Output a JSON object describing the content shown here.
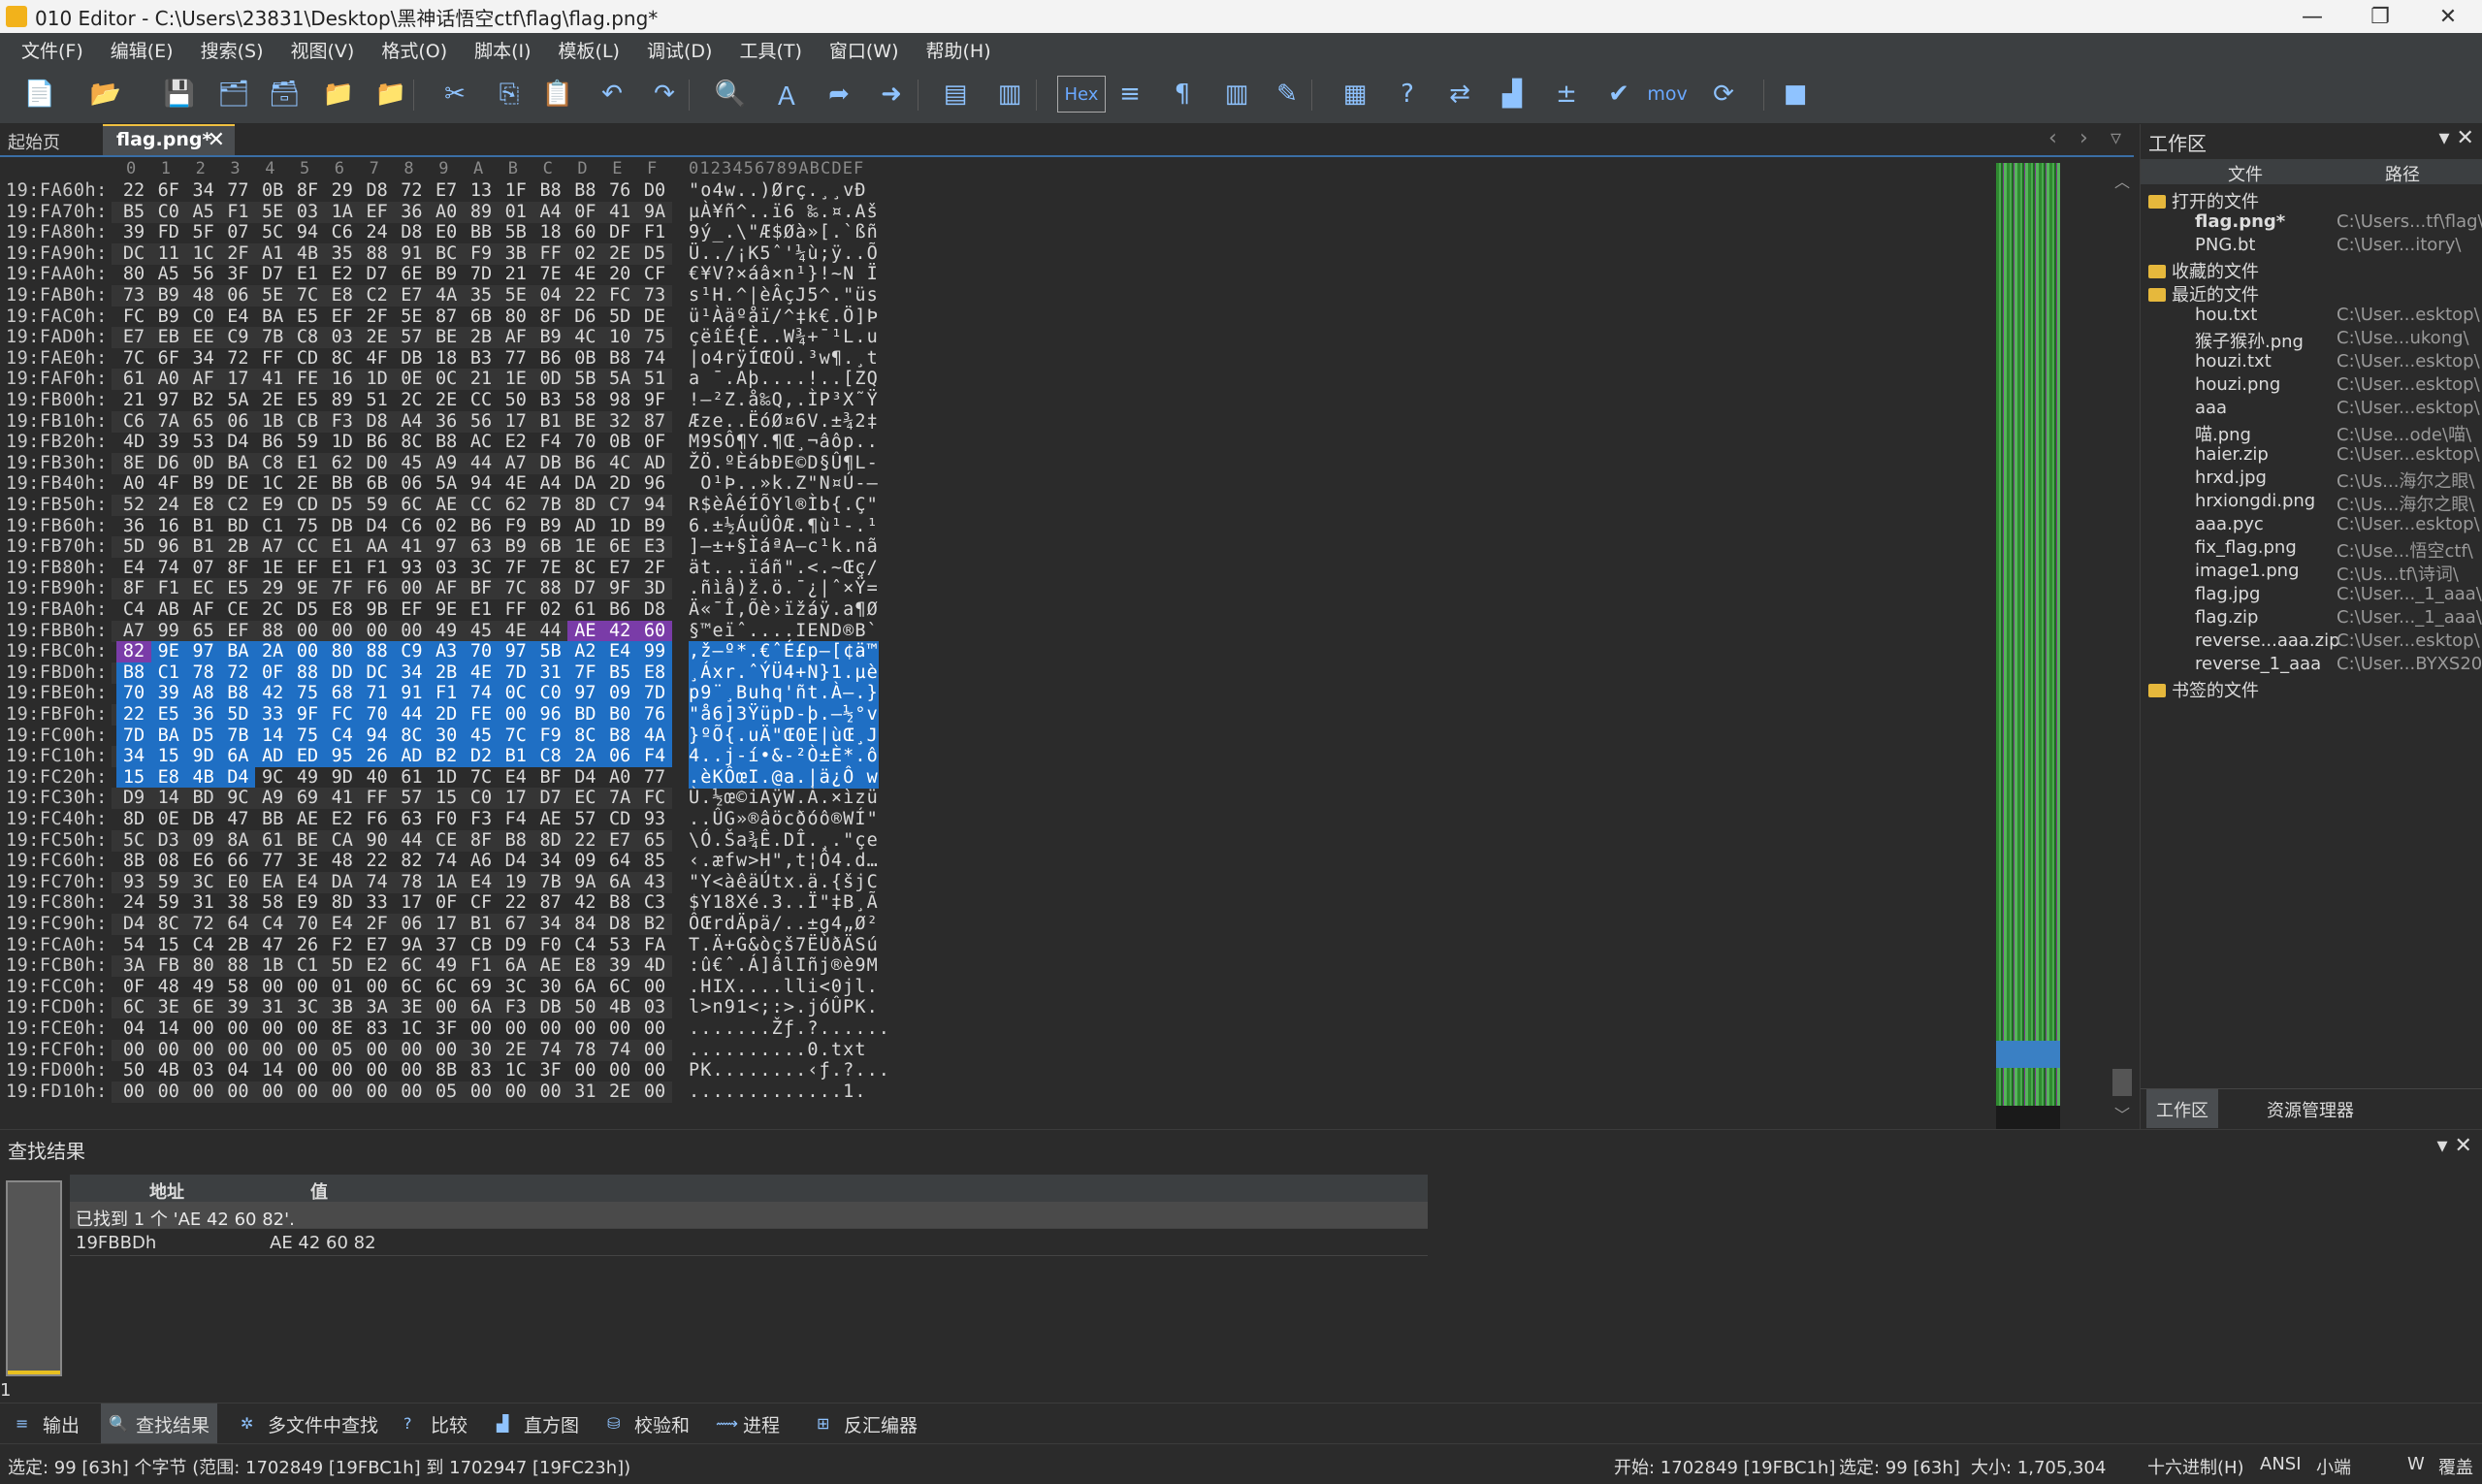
{
  "window": {
    "title": "010 Editor - C:\\Users\\23831\\Desktop\\黑神话悟空ctf\\flag\\flag.png*"
  },
  "menu": [
    "文件(F)",
    "编辑(E)",
    "搜索(S)",
    "视图(V)",
    "格式(O)",
    "脚本(I)",
    "模板(L)",
    "调试(D)",
    "工具(T)",
    "窗口(W)",
    "帮助(H)"
  ],
  "tabs": {
    "start": "起始页",
    "active": "flag.png*",
    "close": "✕"
  },
  "toolbar": {
    "hex_label": "Hex",
    "mov_label": "mov",
    "icons": [
      "new-file-icon",
      "open-folder-icon",
      "save-icon",
      "save-as-icon",
      "save-all-icon",
      "open-folder2-icon",
      "open-multiple-icon",
      "cut-icon",
      "copy-icon",
      "paste-icon",
      "undo-icon",
      "redo-icon",
      "find-icon",
      "replace-icon",
      "goto-icon",
      "jump-arrow-icon",
      "template-icon",
      "script-icon",
      "hex-mode-icon",
      "line-wrap-icon",
      "pilcrow-icon",
      "columns-icon",
      "highlight-icon",
      "calculator-icon",
      "inspector-icon",
      "compare-icon",
      "histogram-icon",
      "checksum-icon",
      "verify-icon",
      "mov-icon",
      "base-convert-icon",
      "stop-icon"
    ]
  },
  "hex_header": {
    "cols": [
      "0",
      "1",
      "2",
      "3",
      "4",
      "5",
      "6",
      "7",
      "8",
      "9",
      "A",
      "B",
      "C",
      "D",
      "E",
      "F"
    ],
    "ascii": "0123456789ABCDEF"
  },
  "hex_rows": [
    {
      "addr": "19:FA60h:",
      "bytes": [
        "22",
        "6F",
        "34",
        "77",
        "0B",
        "8F",
        "29",
        "D8",
        "72",
        "E7",
        "13",
        "1F",
        "B8",
        "B8",
        "76",
        "D0"
      ],
      "ascii": "\"o4w..)Ørç.¸¸vÐ"
    },
    {
      "addr": "19:FA70h:",
      "bytes": [
        "B5",
        "C0",
        "A5",
        "F1",
        "5E",
        "03",
        "1A",
        "EF",
        "36",
        "A0",
        "89",
        "01",
        "A4",
        "0F",
        "41",
        "9A"
      ],
      "ascii": "µÀ¥ñ^..ï6 ‰.¤.Aš"
    },
    {
      "addr": "19:FA80h:",
      "bytes": [
        "39",
        "FD",
        "5F",
        "07",
        "5C",
        "94",
        "C6",
        "24",
        "D8",
        "E0",
        "BB",
        "5B",
        "18",
        "60",
        "DF",
        "F1"
      ],
      "ascii": "9ý_.\\\"Æ$Øà»[.`ßñ"
    },
    {
      "addr": "19:FA90h:",
      "bytes": [
        "DC",
        "11",
        "1C",
        "2F",
        "A1",
        "4B",
        "35",
        "88",
        "91",
        "BC",
        "F9",
        "3B",
        "FF",
        "02",
        "2E",
        "D5"
      ],
      "ascii": "Ü../¡K5ˆ'¼ù;ÿ..Õ"
    },
    {
      "addr": "19:FAA0h:",
      "bytes": [
        "80",
        "A5",
        "56",
        "3F",
        "D7",
        "E1",
        "E2",
        "D7",
        "6E",
        "B9",
        "7D",
        "21",
        "7E",
        "4E",
        "20",
        "CF"
      ],
      "ascii": "€¥V?×áâ×n¹}!~N Ï"
    },
    {
      "addr": "19:FAB0h:",
      "bytes": [
        "73",
        "B9",
        "48",
        "06",
        "5E",
        "7C",
        "E8",
        "C2",
        "E7",
        "4A",
        "35",
        "5E",
        "04",
        "22",
        "FC",
        "73"
      ],
      "ascii": "s¹H.^|èÂçJ5^.\"üs"
    },
    {
      "addr": "19:FAC0h:",
      "bytes": [
        "FC",
        "B9",
        "C0",
        "E4",
        "BA",
        "E5",
        "EF",
        "2F",
        "5E",
        "87",
        "6B",
        "80",
        "8F",
        "D6",
        "5D",
        "DE"
      ],
      "ascii": "ü¹Àäºåï/^‡k€.Ö]Þ"
    },
    {
      "addr": "19:FAD0h:",
      "bytes": [
        "E7",
        "EB",
        "EE",
        "C9",
        "7B",
        "C8",
        "03",
        "2E",
        "57",
        "BE",
        "2B",
        "AF",
        "B9",
        "4C",
        "10",
        "75"
      ],
      "ascii": "çëîÉ{È..W¾+¯¹L.u"
    },
    {
      "addr": "19:FAE0h:",
      "bytes": [
        "7C",
        "6F",
        "34",
        "72",
        "FF",
        "CD",
        "8C",
        "4F",
        "DB",
        "18",
        "B3",
        "77",
        "B6",
        "0B",
        "B8",
        "74"
      ],
      "ascii": "|o4rÿÍŒOÛ.³w¶.¸t"
    },
    {
      "addr": "19:FAF0h:",
      "bytes": [
        "61",
        "A0",
        "AF",
        "17",
        "41",
        "FE",
        "16",
        "1D",
        "0E",
        "0C",
        "21",
        "1E",
        "0D",
        "5B",
        "5A",
        "51"
      ],
      "ascii": "a ¯.Aþ....!..[ZQ"
    },
    {
      "addr": "19:FB00h:",
      "bytes": [
        "21",
        "97",
        "B2",
        "5A",
        "2E",
        "E5",
        "89",
        "51",
        "2C",
        "2E",
        "CC",
        "50",
        "B3",
        "58",
        "98",
        "9F"
      ],
      "ascii": "!—²Z.å‰Q,.ÌP³X˜Ÿ"
    },
    {
      "addr": "19:FB10h:",
      "bytes": [
        "C6",
        "7A",
        "65",
        "06",
        "1B",
        "CB",
        "F3",
        "D8",
        "A4",
        "36",
        "56",
        "17",
        "B1",
        "BE",
        "32",
        "87"
      ],
      "ascii": "Æze..ËóØ¤6V.±¾2‡"
    },
    {
      "addr": "19:FB20h:",
      "bytes": [
        "4D",
        "39",
        "53",
        "D4",
        "B6",
        "59",
        "1D",
        "B6",
        "8C",
        "B8",
        "AC",
        "E2",
        "F4",
        "70",
        "0B",
        "0F"
      ],
      "ascii": "M9SÔ¶Y.¶Œ¸¬âôp.."
    },
    {
      "addr": "19:FB30h:",
      "bytes": [
        "8E",
        "D6",
        "0D",
        "BA",
        "C8",
        "E1",
        "62",
        "D0",
        "45",
        "A9",
        "44",
        "A7",
        "DB",
        "B6",
        "4C",
        "AD"
      ],
      "ascii": "ŽÖ.ºÈábÐE©D§Û¶L-"
    },
    {
      "addr": "19:FB40h:",
      "bytes": [
        "A0",
        "4F",
        "B9",
        "DE",
        "1C",
        "2E",
        "BB",
        "6B",
        "06",
        "5A",
        "94",
        "4E",
        "A4",
        "DA",
        "2D",
        "96"
      ],
      "ascii": " O¹Þ..»k.Z\"N¤Ú-–"
    },
    {
      "addr": "19:FB50h:",
      "bytes": [
        "52",
        "24",
        "E8",
        "C2",
        "E9",
        "CD",
        "D5",
        "59",
        "6C",
        "AE",
        "CC",
        "62",
        "7B",
        "8D",
        "C7",
        "94"
      ],
      "ascii": "R$èÂéÍÕYl®Ìb{.Ç\""
    },
    {
      "addr": "19:FB60h:",
      "bytes": [
        "36",
        "16",
        "B1",
        "BD",
        "C1",
        "75",
        "DB",
        "D4",
        "C6",
        "02",
        "B6",
        "F9",
        "B9",
        "AD",
        "1D",
        "B9"
      ],
      "ascii": "6.±½ÁuÛÔÆ.¶ù¹-.¹"
    },
    {
      "addr": "19:FB70h:",
      "bytes": [
        "5D",
        "96",
        "B1",
        "2B",
        "A7",
        "CC",
        "E1",
        "AA",
        "41",
        "97",
        "63",
        "B9",
        "6B",
        "1E",
        "6E",
        "E3"
      ],
      "ascii": "]–±+§ÌáªA—c¹k.nã"
    },
    {
      "addr": "19:FB80h:",
      "bytes": [
        "E4",
        "74",
        "07",
        "8F",
        "1E",
        "EF",
        "E1",
        "F1",
        "93",
        "03",
        "3C",
        "7F",
        "7E",
        "8C",
        "E7",
        "2F"
      ],
      "ascii": "ät...ïáñ\".<.~Œç/"
    },
    {
      "addr": "19:FB90h:",
      "bytes": [
        "8F",
        "F1",
        "EC",
        "E5",
        "29",
        "9E",
        "7F",
        "F6",
        "00",
        "AF",
        "BF",
        "7C",
        "88",
        "D7",
        "9F",
        "3D"
      ],
      "ascii": ".ñìå)ž.ö.¯¿|ˆ×Ÿ="
    },
    {
      "addr": "19:FBA0h:",
      "bytes": [
        "C4",
        "AB",
        "AF",
        "CE",
        "2C",
        "D5",
        "E8",
        "9B",
        "EF",
        "9E",
        "E1",
        "FF",
        "02",
        "61",
        "B6",
        "D8"
      ],
      "ascii": "Ä«¯Î,Õè›ïžáÿ.a¶Ø"
    },
    {
      "addr": "19:FBB0h:",
      "bytes": [
        "A7",
        "99",
        "65",
        "EF",
        "88",
        "00",
        "00",
        "00",
        "00",
        "49",
        "45",
        "4E",
        "44",
        "AE",
        "42",
        "60"
      ],
      "ascii": "§™eïˆ....IEND®B`"
    },
    {
      "addr": "19:FBC0h:",
      "bytes": [
        "82",
        "9E",
        "97",
        "BA",
        "2A",
        "00",
        "80",
        "88",
        "C9",
        "A3",
        "70",
        "97",
        "5B",
        "A2",
        "E4",
        "99"
      ],
      "ascii": ",ž—º*.€ˆÉ£p—[¢ä™"
    },
    {
      "addr": "19:FBD0h:",
      "bytes": [
        "B8",
        "C1",
        "78",
        "72",
        "0F",
        "88",
        "DD",
        "DC",
        "34",
        "2B",
        "4E",
        "7D",
        "31",
        "7F",
        "B5",
        "E8"
      ],
      "ascii": "¸Áxr.ˆÝÜ4+N}1.µè"
    },
    {
      "addr": "19:FBE0h:",
      "bytes": [
        "70",
        "39",
        "A8",
        "B8",
        "42",
        "75",
        "68",
        "71",
        "91",
        "F1",
        "74",
        "0C",
        "C0",
        "97",
        "09",
        "7D"
      ],
      "ascii": "p9¨¸Buhq'ñt.À—.}"
    },
    {
      "addr": "19:FBF0h:",
      "bytes": [
        "22",
        "E5",
        "36",
        "5D",
        "33",
        "9F",
        "FC",
        "70",
        "44",
        "2D",
        "FE",
        "00",
        "96",
        "BD",
        "B0",
        "76"
      ],
      "ascii": "\"å6]3ŸüpD-þ.–½°v"
    },
    {
      "addr": "19:FC00h:",
      "bytes": [
        "7D",
        "BA",
        "D5",
        "7B",
        "14",
        "75",
        "C4",
        "94",
        "8C",
        "30",
        "45",
        "7C",
        "F9",
        "8C",
        "B8",
        "4A"
      ],
      "ascii": "}ºÕ{.uÄ\"Œ0E|ùŒ¸J"
    },
    {
      "addr": "19:FC10h:",
      "bytes": [
        "34",
        "15",
        "9D",
        "6A",
        "AD",
        "ED",
        "95",
        "26",
        "AD",
        "B2",
        "D2",
        "B1",
        "C8",
        "2A",
        "06",
        "F4"
      ],
      "ascii": "4..j-í•&-²Ò±È*.ô"
    },
    {
      "addr": "19:FC20h:",
      "bytes": [
        "15",
        "E8",
        "4B",
        "D4",
        "9C",
        "49",
        "9D",
        "40",
        "61",
        "1D",
        "7C",
        "E4",
        "BF",
        "D4",
        "A0",
        "77"
      ],
      "ascii": ".èKÔœI.@a.|ä¿Ô w"
    },
    {
      "addr": "19:FC30h:",
      "bytes": [
        "D9",
        "14",
        "BD",
        "9C",
        "A9",
        "69",
        "41",
        "FF",
        "57",
        "15",
        "C0",
        "17",
        "D7",
        "EC",
        "7A",
        "FC"
      ],
      "ascii": "Ù.½œ©iAÿW.À.×ìzü"
    },
    {
      "addr": "19:FC40h:",
      "bytes": [
        "8D",
        "0E",
        "DB",
        "47",
        "BB",
        "AE",
        "E2",
        "F6",
        "63",
        "F0",
        "F3",
        "F4",
        "AE",
        "57",
        "CD",
        "93"
      ],
      "ascii": "..ÛG»®âöcðóô®WÍ\""
    },
    {
      "addr": "19:FC50h:",
      "bytes": [
        "5C",
        "D3",
        "09",
        "8A",
        "61",
        "BE",
        "CA",
        "90",
        "44",
        "CE",
        "8F",
        "B8",
        "8D",
        "22",
        "E7",
        "65"
      ],
      "ascii": "\\Ó.Ša¾Ê.DÎ.¸.\"çe"
    },
    {
      "addr": "19:FC60h:",
      "bytes": [
        "8B",
        "08",
        "E6",
        "66",
        "77",
        "3E",
        "48",
        "22",
        "82",
        "74",
        "A6",
        "D4",
        "34",
        "09",
        "64",
        "85"
      ],
      "ascii": "‹.æfw>H\",t¦Ô4.d…"
    },
    {
      "addr": "19:FC70h:",
      "bytes": [
        "93",
        "59",
        "3C",
        "E0",
        "EA",
        "E4",
        "DA",
        "74",
        "78",
        "1A",
        "E4",
        "19",
        "7B",
        "9A",
        "6A",
        "43"
      ],
      "ascii": "\"Y<àêäÚtx.ä.{šjC"
    },
    {
      "addr": "19:FC80h:",
      "bytes": [
        "24",
        "59",
        "31",
        "38",
        "58",
        "E9",
        "8D",
        "33",
        "17",
        "0F",
        "CF",
        "22",
        "87",
        "42",
        "B8",
        "C3"
      ],
      "ascii": "$Y18Xé.3..Ï\"‡B¸Ã"
    },
    {
      "addr": "19:FC90h:",
      "bytes": [
        "D4",
        "8C",
        "72",
        "64",
        "C4",
        "70",
        "E4",
        "2F",
        "06",
        "17",
        "B1",
        "67",
        "34",
        "84",
        "D8",
        "B2"
      ],
      "ascii": "ÔŒrdÄpä/..±g4„Ø²"
    },
    {
      "addr": "19:FCA0h:",
      "bytes": [
        "54",
        "15",
        "C4",
        "2B",
        "47",
        "26",
        "F2",
        "E7",
        "9A",
        "37",
        "CB",
        "D9",
        "F0",
        "C4",
        "53",
        "FA"
      ],
      "ascii": "T.Ä+G&òçš7ËÙðÄSú"
    },
    {
      "addr": "19:FCB0h:",
      "bytes": [
        "3A",
        "FB",
        "80",
        "88",
        "1B",
        "C1",
        "5D",
        "E2",
        "6C",
        "49",
        "F1",
        "6A",
        "AE",
        "E8",
        "39",
        "4D"
      ],
      "ascii": ":û€ˆ.Á]âlIñj®è9M"
    },
    {
      "addr": "19:FCC0h:",
      "bytes": [
        "0F",
        "48",
        "49",
        "58",
        "00",
        "00",
        "01",
        "00",
        "6C",
        "6C",
        "69",
        "3C",
        "30",
        "6A",
        "6C",
        "00"
      ],
      "ascii": ".HIX....lli<0jl."
    },
    {
      "addr": "19:FCD0h:",
      "bytes": [
        "6C",
        "3E",
        "6E",
        "39",
        "31",
        "3C",
        "3B",
        "3A",
        "3E",
        "00",
        "6A",
        "F3",
        "DB",
        "50",
        "4B",
        "03"
      ],
      "ascii": "l>n91<;:>.jóÛPK."
    },
    {
      "addr": "19:FCE0h:",
      "bytes": [
        "04",
        "14",
        "00",
        "00",
        "00",
        "00",
        "8E",
        "83",
        "1C",
        "3F",
        "00",
        "00",
        "00",
        "00",
        "00",
        "00"
      ],
      "ascii": ".......Žƒ.?......"
    },
    {
      "addr": "19:FCF0h:",
      "bytes": [
        "00",
        "00",
        "00",
        "00",
        "00",
        "00",
        "05",
        "00",
        "00",
        "00",
        "30",
        "2E",
        "74",
        "78",
        "74",
        "00"
      ],
      "ascii": "..........0.txt"
    },
    {
      "addr": "19:FD00h:",
      "bytes": [
        "50",
        "4B",
        "03",
        "04",
        "14",
        "00",
        "00",
        "00",
        "00",
        "8B",
        "83",
        "1C",
        "3F",
        "00",
        "00",
        "00"
      ],
      "ascii": "PK........‹ƒ.?..."
    },
    {
      "addr": "19:FD10h:",
      "bytes": [
        "00",
        "00",
        "00",
        "00",
        "00",
        "00",
        "00",
        "00",
        "00",
        "05",
        "00",
        "00",
        "00",
        "31",
        "2E",
        "00"
      ],
      "ascii": ".............1."
    }
  ],
  "workspace": {
    "title": "工作区",
    "col_file": "文件",
    "col_path": "路径",
    "sections": {
      "open": "打开的文件",
      "fav": "收藏的文件",
      "recent": "最近的文件",
      "bookmark": "书签的文件"
    },
    "open_files": [
      {
        "name": "flag.png*",
        "path": "C:\\Users...tf\\flag\\"
      },
      {
        "name": "PNG.bt",
        "path": "C:\\User...itory\\"
      }
    ],
    "recent_files": [
      {
        "name": "hou.txt",
        "path": "C:\\User...esktop\\"
      },
      {
        "name": "猴子猴孙.png",
        "path": "C:\\Use...ukong\\"
      },
      {
        "name": "houzi.txt",
        "path": "C:\\User...esktop\\"
      },
      {
        "name": "houzi.png",
        "path": "C:\\User...esktop\\"
      },
      {
        "name": "aaa",
        "path": "C:\\User...esktop\\"
      },
      {
        "name": "喵.png",
        "path": "C:\\Use...ode\\喵\\"
      },
      {
        "name": "haier.zip",
        "path": "C:\\User...esktop\\"
      },
      {
        "name": "hrxd.jpg",
        "path": "C:\\Us...海尔之眼\\"
      },
      {
        "name": "hrxiongdi.png",
        "path": "C:\\Us...海尔之眼\\"
      },
      {
        "name": "aaa.pyc",
        "path": "C:\\User...esktop\\"
      },
      {
        "name": "fix_flag.png",
        "path": "C:\\Use...悟空ctf\\"
      },
      {
        "name": "image1.png",
        "path": "C:\\Us...tf\\诗词\\"
      },
      {
        "name": "flag.jpg",
        "path": "C:\\User..._1_aaa\\"
      },
      {
        "name": "flag.zip",
        "path": "C:\\User..._1_aaa\\"
      },
      {
        "name": "reverse...aaa.zip",
        "path": "C:\\User...esktop\\"
      },
      {
        "name": "reverse_1_aaa",
        "path": "C:\\User...BYXS20\\"
      }
    ],
    "tab_workspace": "工作区",
    "tab_explorer": "资源管理器"
  },
  "find": {
    "title": "查找结果",
    "col_addr": "地址",
    "col_value": "值",
    "summary": "已找到 1 个 'AE 42 60 82'.",
    "rows": [
      {
        "addr": "19FBBDh",
        "value": "AE 42 60 82"
      }
    ],
    "line_no": "1"
  },
  "bottom_tabs": [
    "输出",
    "查找结果",
    "多文件中查找",
    "比较",
    "直方图",
    "校验和",
    "进程",
    "反汇编器"
  ],
  "status": {
    "left": "选定: 99 [63h] 个字节 (范围: 1702849 [19FBC1h] 到 1702947 [19FC23h])",
    "start": "开始: 1702849 [19FBC1h]",
    "sel": "选定: 99 [63h]",
    "size": "大小: 1,705,304",
    "mode": "十六进制(H)",
    "enc": "ANSI",
    "endian": "小端",
    "w": "W",
    "ovr": "覆盖"
  },
  "colors": {
    "selection": "#1f6fc4",
    "find_highlight": "#7a3ca8",
    "background": "#2b2b2b"
  }
}
